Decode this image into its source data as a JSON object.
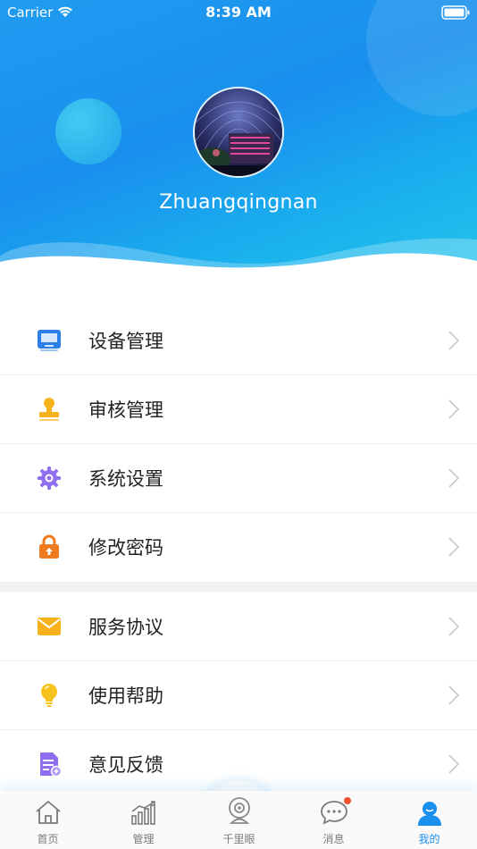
{
  "status_bar": {
    "carrier": "Carrier",
    "time": "8:39 AM"
  },
  "profile": {
    "username": "Zhuangqingnan"
  },
  "menu_group_1": [
    {
      "label": "设备管理",
      "icon": "device-monitor-icon",
      "color": "#2d7fe8"
    },
    {
      "label": "审核管理",
      "icon": "stamp-icon",
      "color": "#f7b21b"
    },
    {
      "label": "系统设置",
      "icon": "gear-icon",
      "color": "#8f6ef0"
    },
    {
      "label": "修改密码",
      "icon": "lock-icon",
      "color": "#f07a1e"
    }
  ],
  "menu_group_2": [
    {
      "label": "服务协议",
      "icon": "envelope-icon",
      "color": "#f7b21b"
    },
    {
      "label": "使用帮助",
      "icon": "lightbulb-icon",
      "color": "#f7c21b"
    },
    {
      "label": "意见反馈",
      "icon": "feedback-document-icon",
      "color": "#8f6ef0"
    }
  ],
  "tab_bar": {
    "tabs": [
      {
        "label": "首页",
        "icon": "home-icon"
      },
      {
        "label": "管理",
        "icon": "chart-icon"
      },
      {
        "label": "千里眼",
        "icon": "camera-icon"
      },
      {
        "label": "消息",
        "icon": "message-icon"
      },
      {
        "label": "我的",
        "icon": "user-icon"
      }
    ],
    "active_index": 4,
    "active_color": "#1a8fee",
    "inactive_color": "#7a7a7a"
  },
  "colors": {
    "header_blue": "#1a8fee",
    "badge_red": "#f0502c"
  }
}
